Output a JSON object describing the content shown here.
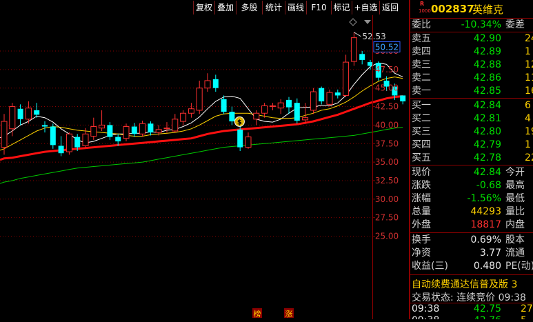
{
  "toolbar": {
    "buttons": [
      "复权",
      "叠加",
      "多股",
      "统计",
      "画线",
      "F10",
      "标记",
      "+自选",
      "返回"
    ]
  },
  "chart": {
    "high_label": "52.53",
    "price_tag": "50.52",
    "y_ticks": [
      "50.00",
      "47.50",
      "45.00",
      "42.50",
      "40.00",
      "37.50",
      "35.00",
      "32.50",
      "30.00",
      "27.50",
      "25.00"
    ],
    "marker_bang": "榜",
    "marker_zhang": "涨",
    "coin_label": "$"
  },
  "chart_data": {
    "type": "candlestick",
    "ylim": [
      24,
      53
    ],
    "y_ticks": [
      50.0,
      47.5,
      45.0,
      42.5,
      40.0,
      37.5,
      35.0,
      32.5,
      30.0,
      27.5,
      25.0
    ],
    "candles": [
      {
        "o": 37.0,
        "c": 40.5,
        "h": 41.5,
        "l": 36.0
      },
      {
        "o": 39.5,
        "c": 42.5,
        "h": 43.0,
        "l": 38.5
      },
      {
        "o": 42.2,
        "c": 40.8,
        "h": 42.8,
        "l": 40.0
      },
      {
        "o": 40.8,
        "c": 42.3,
        "h": 43.2,
        "l": 40.2
      },
      {
        "o": 42.0,
        "c": 41.4,
        "h": 43.0,
        "l": 41.0
      },
      {
        "o": 40.0,
        "c": 39.8,
        "h": 40.5,
        "l": 39.0
      },
      {
        "o": 39.8,
        "c": 37.3,
        "h": 40.2,
        "l": 36.8
      },
      {
        "o": 37.2,
        "c": 36.2,
        "h": 38.5,
        "l": 35.8
      },
      {
        "o": 36.4,
        "c": 38.8,
        "h": 39.0,
        "l": 36.0
      },
      {
        "o": 38.4,
        "c": 37.0,
        "h": 38.8,
        "l": 36.5
      },
      {
        "o": 37.2,
        "c": 38.8,
        "h": 39.6,
        "l": 37.0
      },
      {
        "o": 38.5,
        "c": 39.8,
        "h": 41.0,
        "l": 38.0
      },
      {
        "o": 39.6,
        "c": 40.0,
        "h": 42.0,
        "l": 39.2
      },
      {
        "o": 40.0,
        "c": 38.4,
        "h": 40.4,
        "l": 38.0
      },
      {
        "o": 38.4,
        "c": 37.8,
        "h": 38.8,
        "l": 37.2
      },
      {
        "o": 38.2,
        "c": 39.8,
        "h": 40.2,
        "l": 37.8
      },
      {
        "o": 39.8,
        "c": 38.8,
        "h": 40.3,
        "l": 38.4
      },
      {
        "o": 38.8,
        "c": 40.2,
        "h": 40.6,
        "l": 38.4
      },
      {
        "o": 40.2,
        "c": 39.0,
        "h": 40.5,
        "l": 38.6
      },
      {
        "o": 39.0,
        "c": 39.4,
        "h": 40.0,
        "l": 38.6
      },
      {
        "o": 39.5,
        "c": 39.6,
        "h": 40.4,
        "l": 39.0
      },
      {
        "o": 39.2,
        "c": 40.8,
        "h": 41.5,
        "l": 39.0
      },
      {
        "o": 40.5,
        "c": 41.6,
        "h": 42.0,
        "l": 40.0
      },
      {
        "o": 41.6,
        "c": 42.2,
        "h": 43.0,
        "l": 41.0
      },
      {
        "o": 42.0,
        "c": 45.0,
        "h": 46.0,
        "l": 41.5
      },
      {
        "o": 45.0,
        "c": 46.0,
        "h": 47.0,
        "l": 44.5
      },
      {
        "o": 46.2,
        "c": 45.0,
        "h": 46.8,
        "l": 44.5
      },
      {
        "o": 43.5,
        "c": 41.8,
        "h": 44.0,
        "l": 41.5
      },
      {
        "o": 41.8,
        "c": 40.5,
        "h": 42.5,
        "l": 40.0
      },
      {
        "o": 39.4,
        "c": 37.0,
        "h": 40.0,
        "l": 36.5
      },
      {
        "o": 37.0,
        "c": 38.4,
        "h": 39.0,
        "l": 36.8
      },
      {
        "o": 40.8,
        "c": 41.6,
        "h": 42.0,
        "l": 40.0
      },
      {
        "o": 41.6,
        "c": 42.6,
        "h": 43.0,
        "l": 41.0
      },
      {
        "o": 42.5,
        "c": 42.6,
        "h": 43.0,
        "l": 42.0
      },
      {
        "o": 42.3,
        "c": 43.0,
        "h": 43.5,
        "l": 41.5
      },
      {
        "o": 43.4,
        "c": 42.4,
        "h": 43.8,
        "l": 41.5
      },
      {
        "o": 43.0,
        "c": 40.6,
        "h": 43.6,
        "l": 40.2
      },
      {
        "o": 40.7,
        "c": 41.0,
        "h": 43.0,
        "l": 40.2
      },
      {
        "o": 42.0,
        "c": 44.5,
        "h": 45.0,
        "l": 41.5
      },
      {
        "o": 45.0,
        "c": 43.2,
        "h": 45.2,
        "l": 42.8
      },
      {
        "o": 42.8,
        "c": 44.4,
        "h": 44.8,
        "l": 42.5
      },
      {
        "o": 44.4,
        "c": 44.0,
        "h": 44.8,
        "l": 43.6
      },
      {
        "o": 44.0,
        "c": 48.5,
        "h": 49.5,
        "l": 43.8
      },
      {
        "o": 48.6,
        "c": 51.8,
        "h": 52.53,
        "l": 48.0
      },
      {
        "o": 49.6,
        "c": 48.8,
        "h": 50.0,
        "l": 48.2
      },
      {
        "o": 48.5,
        "c": 48.0,
        "h": 48.8,
        "l": 47.5
      },
      {
        "o": 48.4,
        "c": 46.4,
        "h": 48.6,
        "l": 46.0
      },
      {
        "o": 46.0,
        "c": 45.2,
        "h": 46.6,
        "l": 44.6
      },
      {
        "o": 45.2,
        "c": 44.0,
        "h": 45.6,
        "l": 43.4
      },
      {
        "o": 44.0,
        "c": 43.2,
        "h": 44.0,
        "l": 42.8
      }
    ],
    "series": [
      {
        "name": "MA5",
        "color": "#ffffff",
        "values": [
          38.5,
          39.2,
          40.0,
          40.5,
          41.2,
          41.0,
          40.4,
          39.5,
          38.8,
          38.0,
          37.6,
          37.8,
          38.2,
          38.6,
          38.8,
          38.8,
          38.9,
          38.9,
          39.1,
          39.0,
          39.3,
          39.4,
          39.8,
          40.3,
          41.1,
          42.2,
          43.2,
          43.8,
          43.9,
          43.6,
          42.2,
          40.8,
          40.5,
          40.4,
          40.8,
          41.6,
          42.3,
          42.4,
          42.4,
          42.7,
          42.6,
          43.0,
          44.0,
          45.5,
          46.8,
          47.9,
          48.4,
          48.2,
          47.0,
          46.5
        ]
      },
      {
        "name": "MA10",
        "color": "#ffd200",
        "values": [
          36.8,
          37.4,
          38.0,
          38.6,
          39.2,
          39.6,
          39.8,
          39.7,
          39.5,
          39.3,
          39.2,
          39.1,
          39.0,
          38.9,
          38.8,
          38.6,
          38.5,
          38.5,
          38.7,
          38.8,
          38.9,
          39.0,
          39.2,
          39.5,
          40.0,
          40.6,
          41.2,
          41.5,
          41.6,
          41.6,
          41.6,
          41.4,
          41.2,
          41.0,
          40.9,
          40.9,
          41.0,
          41.3,
          41.6,
          42.0,
          42.2,
          42.6,
          43.1,
          43.8,
          44.6,
          45.3,
          45.9,
          46.3,
          46.5,
          46.3
        ]
      },
      {
        "name": "MA20",
        "color": "#ff1010",
        "values": [
          35.5,
          35.6,
          35.8,
          36.0,
          36.2,
          36.4,
          36.5,
          36.6,
          36.7,
          36.8,
          36.9,
          37.0,
          37.1,
          37.2,
          37.3,
          37.4,
          37.5,
          37.6,
          37.7,
          37.8,
          37.9,
          38.0,
          38.1,
          38.2,
          38.5,
          38.8,
          39.0,
          39.2,
          39.3,
          39.4,
          39.5,
          39.6,
          39.7,
          39.8,
          39.9,
          40.0,
          40.1,
          40.3,
          40.5,
          40.8,
          41.1,
          41.4,
          41.8,
          42.2,
          42.6,
          43.0,
          43.3,
          43.6,
          43.8,
          43.9
        ]
      },
      {
        "name": "MA60",
        "color": "#00c800",
        "values": [
          32.3,
          32.5,
          32.8,
          33.0,
          33.2,
          33.4,
          33.6,
          33.8,
          34.0,
          34.2,
          34.3,
          34.4,
          34.5,
          34.6,
          34.7,
          34.8,
          34.9,
          35.0,
          35.2,
          35.4,
          35.6,
          35.8,
          36.0,
          36.2,
          36.4,
          36.6,
          36.8,
          37.0,
          37.1,
          37.2,
          37.3,
          37.4,
          37.5,
          37.6,
          37.7,
          37.8,
          37.9,
          38.0,
          38.1,
          38.2,
          38.3,
          38.4,
          38.5,
          38.6,
          38.8,
          39.0,
          39.2,
          39.4,
          39.6,
          39.7
        ]
      }
    ]
  },
  "quote": {
    "code": "002837",
    "name": "英维克",
    "logo_top": "R",
    "logo_bottom": "1000",
    "weibi_label": "委比",
    "weibi_value": "-10.34%",
    "weicha_label": "委差",
    "asks": [
      {
        "label": "卖五",
        "price": "42.90",
        "vol": "24"
      },
      {
        "label": "卖四",
        "price": "42.89",
        "vol": "1"
      },
      {
        "label": "卖三",
        "price": "42.88",
        "vol": "12"
      },
      {
        "label": "卖二",
        "price": "42.86",
        "vol": "11"
      },
      {
        "label": "卖一",
        "price": "42.85",
        "vol": "16"
      }
    ],
    "bids": [
      {
        "label": "买一",
        "price": "42.84",
        "vol": "6"
      },
      {
        "label": "买二",
        "price": "42.81",
        "vol": "4"
      },
      {
        "label": "买三",
        "price": "42.80",
        "vol": "19"
      },
      {
        "label": "买四",
        "price": "42.79",
        "vol": "1"
      },
      {
        "label": "买五",
        "price": "42.78",
        "vol": "22"
      }
    ],
    "stats": [
      {
        "label": "现价",
        "value": "42.84",
        "label2": "今开",
        "color": "green"
      },
      {
        "label": "涨跌",
        "value": "-0.68",
        "label2": "最高",
        "color": "green"
      },
      {
        "label": "涨幅",
        "value": "-1.56%",
        "label2": "最低",
        "color": "green"
      },
      {
        "label": "总量",
        "value": "44293",
        "label2": "量比",
        "color": "yellow"
      },
      {
        "label": "外盘",
        "value": "18817",
        "label2": "内盘",
        "color": "red"
      }
    ],
    "stats2": [
      {
        "label": "换手",
        "value": "0.69%",
        "label2": "股本"
      },
      {
        "label": "净资",
        "value": "3.77",
        "label2": "流通"
      },
      {
        "label": "收益(三)",
        "value": "0.480",
        "label2": "PE(动)"
      }
    ],
    "ticker": "自动续费通达信普及版  3",
    "trade_status": "交易状态: 连续竞价  09:38",
    "ticks": [
      {
        "time": "09:38",
        "price": "42.75",
        "vol": "27"
      },
      {
        "time": "09:38",
        "price": "42.76",
        "vol": "5"
      }
    ]
  }
}
